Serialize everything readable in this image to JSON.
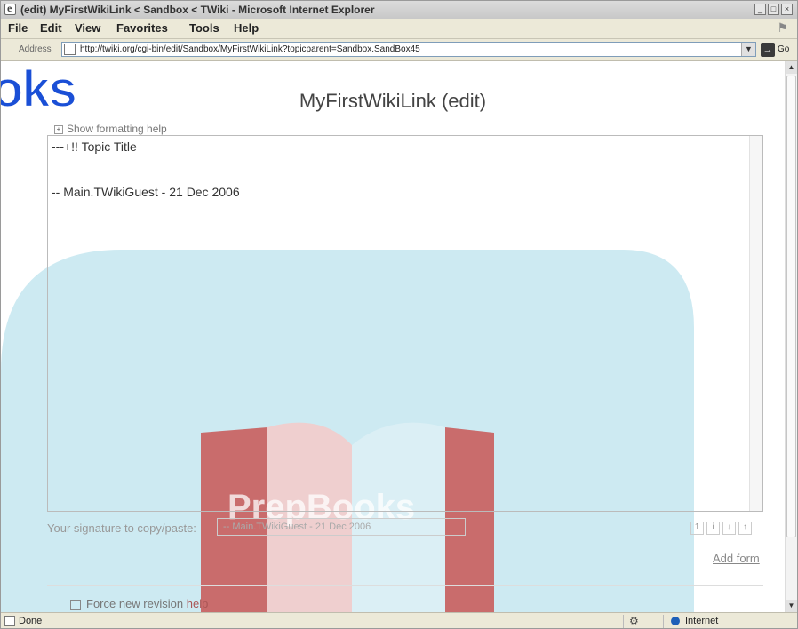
{
  "window": {
    "title": "(edit) MyFirstWikiLink < Sandbox < TWiki - Microsoft Internet Explorer"
  },
  "menu": {
    "items": [
      "File",
      "Edit",
      "View",
      "Favorites",
      "Tools",
      "Help"
    ]
  },
  "address": {
    "label": "Address",
    "url": "http://twiki.org/cgi-bin/edit/Sandbox/MyFirstWikiLink?topicparent=Sandbox.SandBox45",
    "go_label": "Go"
  },
  "watermark": {
    "top_text": "oks",
    "book_text": "PrepBooks"
  },
  "page": {
    "title": "MyFirstWikiLink (edit)",
    "formatting_help": "Show formatting help",
    "editor": {
      "line1": "---+!! Topic Title",
      "line2": "-- Main.TWikiGuest - 21 Dec 2006"
    },
    "signature_label": "Your signature to copy/paste:",
    "signature_value": "-- Main.TWikiGuest - 21 Dec 2006",
    "add_form": "Add form",
    "force_revision": "Force new revision",
    "force_help": "help"
  },
  "status": {
    "text": "Done",
    "zone": "Internet"
  },
  "colors": {
    "watermark_blue": "#1a4fd6",
    "watermark_cyan": "#cdeaf2",
    "book_red": "#b0282a"
  }
}
